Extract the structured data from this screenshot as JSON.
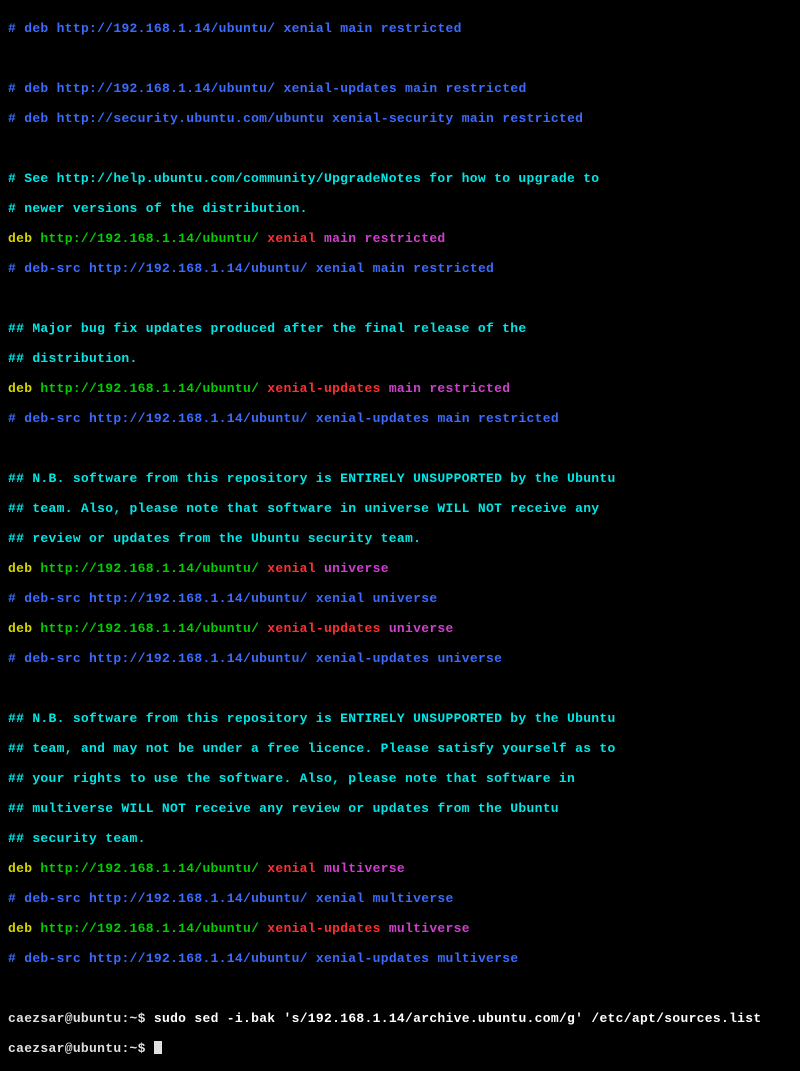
{
  "ip": "192.168.1.14",
  "repo": "/ubuntu/",
  "dists": {
    "x": "xenial",
    "xu": "xenial-updates",
    "xs": "xenial-security"
  },
  "comp": {
    "m": "main",
    "r": "restricted",
    "u": "universe",
    "mv": "multiverse"
  },
  "prompt": {
    "user": "caezsar",
    "host": "ubuntu",
    "path": "~",
    "sep1": "@",
    "sep2": ":",
    "sigil": "$"
  },
  "cmd": {
    "sudo": "sudo",
    "sed": "sed -i.bak 's/192.168.1.14/archive.ubuntu.com/g' /etc/apt/sources.list"
  },
  "txt": {
    "hash": "#",
    "dhash": "##",
    "deb": "deb",
    "debsrc": "deb-src",
    "http": "http://",
    "see": "See http://help.ubuntu.com/community/UpgradeNotes for how to upgrade to",
    "newer": "newer versions of the distribution.",
    "sec_host": "security.ubuntu.com/ubuntu",
    "major1": "Major bug fix updates produced after the final release of the",
    "major2": "distribution.",
    "nb1a": "N.B. software from this repository is ENTIRELY UNSUPPORTED by the Ubuntu",
    "nb1b": "team. Also, please note that software in universe WILL NOT receive any",
    "nb1c": "review or updates from the Ubuntu security team.",
    "nb2a": "N.B. software from this repository is ENTIRELY UNSUPPORTED by the Ubuntu",
    "nb2b": "team, and may not be under a free licence. Please satisfy yourself as to",
    "nb2c": "your rights to use the software. Also, please note that software in",
    "nb2d": "multiverse WILL NOT receive any review or updates from the Ubuntu",
    "nb2e": "security team."
  }
}
